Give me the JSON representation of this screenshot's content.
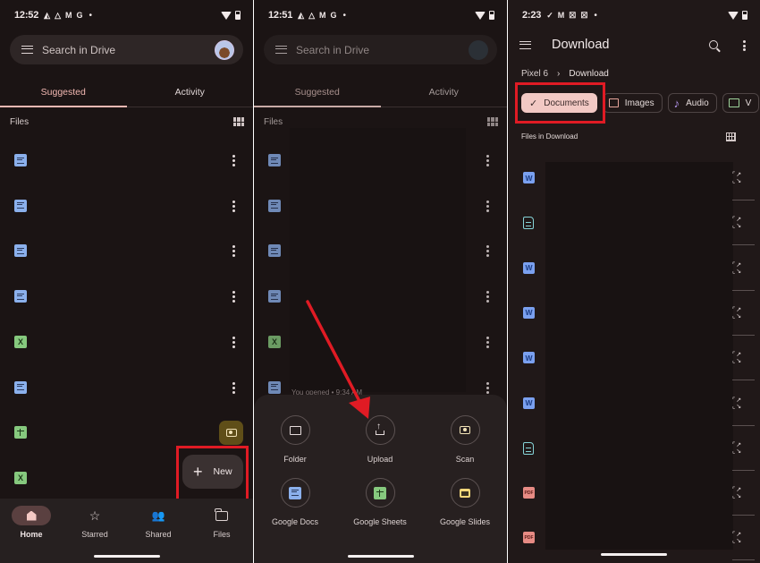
{
  "panel1": {
    "status": {
      "time": "12:52",
      "icons": [
        "drive-icon",
        "drive-outline-icon",
        "gmail-icon",
        "google-icon"
      ]
    },
    "search_placeholder": "Search in Drive",
    "tabs": [
      {
        "label": "Suggested",
        "active": true
      },
      {
        "label": "Activity",
        "active": false
      }
    ],
    "files_header": "Files",
    "files": [
      "doc",
      "doc",
      "doc",
      "doc",
      "xls",
      "doc",
      "sheet",
      "xls"
    ],
    "fab_label": "New",
    "bottom_nav": [
      {
        "label": "Home",
        "active": true
      },
      {
        "label": "Starred",
        "active": false
      },
      {
        "label": "Shared",
        "active": false
      },
      {
        "label": "Files",
        "active": false
      }
    ]
  },
  "panel2": {
    "status": {
      "time": "12:51"
    },
    "search_placeholder": "Search in Drive",
    "tabs": [
      {
        "label": "Suggested",
        "active": true
      },
      {
        "label": "Activity",
        "active": false
      }
    ],
    "files_header": "Files",
    "files": [
      "doc",
      "doc",
      "doc",
      "doc",
      "xls",
      "doc"
    ],
    "opened_text": "You opened • 9:34 AM",
    "create_options": [
      {
        "label": "Folder",
        "icon": "folder-icon"
      },
      {
        "label": "Upload",
        "icon": "upload-icon"
      },
      {
        "label": "Scan",
        "icon": "camera-icon"
      },
      {
        "label": "Google Docs",
        "icon": "docs-icon"
      },
      {
        "label": "Google Sheets",
        "icon": "sheets-icon"
      },
      {
        "label": "Google Slides",
        "icon": "slides-icon"
      }
    ]
  },
  "panel3": {
    "status": {
      "time": "2:23"
    },
    "title": "Download",
    "breadcrumb": [
      "Pixel 6",
      "Download"
    ],
    "chips": [
      {
        "label": "Documents",
        "selected": true
      },
      {
        "label": "Images",
        "selected": false
      },
      {
        "label": "Audio",
        "selected": false
      },
      {
        "label": "V",
        "selected": false
      }
    ],
    "files_header": "Files in Download",
    "files": [
      {
        "type": "W"
      },
      {
        "type": "txt"
      },
      {
        "type": "W"
      },
      {
        "type": "W"
      },
      {
        "type": "W"
      },
      {
        "type": "W"
      },
      {
        "type": "txt"
      },
      {
        "type": "PDF"
      },
      {
        "type": "PDF"
      }
    ]
  },
  "colors": {
    "background": "#1b1414",
    "accent": "#f2b8b2",
    "highlight_box": "#e01b24",
    "arrow": "#e01b24"
  }
}
